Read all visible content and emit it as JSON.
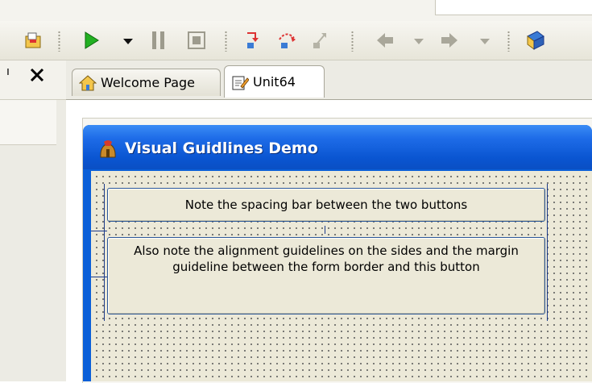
{
  "toolbar": {
    "items": [
      {
        "icon": "open-project-icon"
      },
      {
        "icon": "run-icon",
        "color": "#20b020"
      },
      {
        "icon": "run-dropdown-icon"
      },
      {
        "icon": "pause-icon"
      },
      {
        "icon": "stop-icon"
      },
      {
        "icon": "trace-into-icon"
      },
      {
        "icon": "step-over-icon"
      },
      {
        "icon": "run-to-cursor-icon"
      },
      {
        "icon": "back-icon"
      },
      {
        "icon": "back-dropdown-icon"
      },
      {
        "icon": "forward-icon"
      },
      {
        "icon": "forward-dropdown-icon"
      },
      {
        "icon": "help-book-icon"
      }
    ]
  },
  "left_panel": {
    "tab_fragment": "ı",
    "close_icon": "close-icon"
  },
  "tabs": [
    {
      "label": "Welcome Page",
      "icon": "home-icon",
      "active": false
    },
    {
      "label": "Unit64",
      "icon": "edit-unit-icon",
      "active": true
    }
  ],
  "form": {
    "title": "Visual Guidlines Demo",
    "title_color": "#0a55d1",
    "guideline_color": "#1b3a8a",
    "buttons": [
      {
        "caption": "Note the spacing bar between the two buttons"
      },
      {
        "caption": "Also note the alignment guidelines on the sides and the margin guideline between the form border and this button"
      }
    ]
  }
}
